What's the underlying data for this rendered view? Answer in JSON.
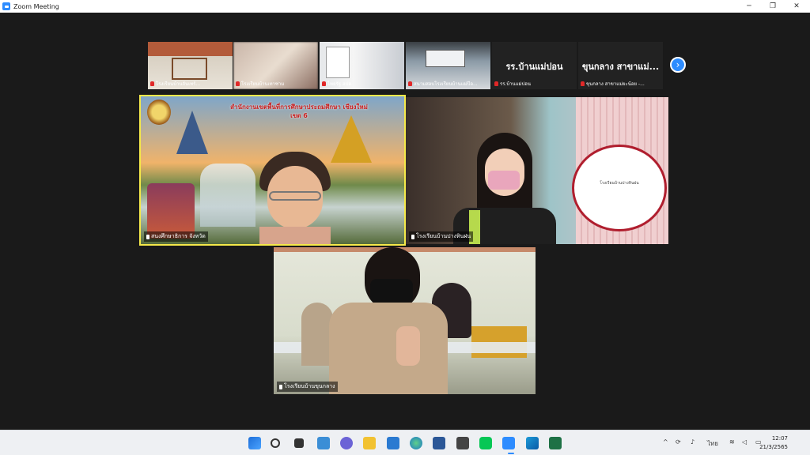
{
  "window": {
    "title": "Zoom Meeting"
  },
  "colors": {
    "accent": "#2D8CFF",
    "active_speaker": "#F5E94A",
    "mic_muted": "#E02828"
  },
  "gallery": [
    {
      "name": "โรงเรียนบ้านจันเทร์..."
    },
    {
      "name": "โรงเรียนบ้านเทาซ่าม"
    },
    {
      "name": "ไทยรัฐ ฮปฮ"
    },
    {
      "name": "สนามสอบโรงเรียนบ้านแม่ป๊อ..."
    },
    {
      "name": "รร.บ้านแม่ปอน",
      "display": "รร.บ้านแม่ปอน"
    },
    {
      "name": "ขุนกลาง สาขาแม่ยะน้อย -...",
      "display": "ขุนกลาง สาขาแม่..."
    }
  ],
  "tiles": {
    "speaker": {
      "name": "สนงศึกษาธิการ จังหวัด",
      "banner": "สำนักงานเขตพื้นที่การศึกษาประถมศึกษา เชียงใหม่ เขต 6"
    },
    "right": {
      "name": "โรงเรียนบ้านปางหินฝน",
      "logo_text": "โรงเรียนบ้านปางหินฝน"
    },
    "bottom": {
      "name": "โรงเรียนบ้านขุนกลาง"
    }
  },
  "taskbar": {
    "apps": [
      "start-icon",
      "search-icon",
      "task-view-icon",
      "widgets-icon",
      "teams-chat-icon",
      "file-explorer-icon",
      "mail-icon",
      "edge-icon",
      "word-icon",
      "graduation-app-icon",
      "line-icon",
      "zoom-icon",
      "photos-icon",
      "excel-icon"
    ],
    "tray": {
      "lang": "ไทย"
    },
    "clock": {
      "time": "12:07",
      "date": "21/3/2565"
    }
  }
}
